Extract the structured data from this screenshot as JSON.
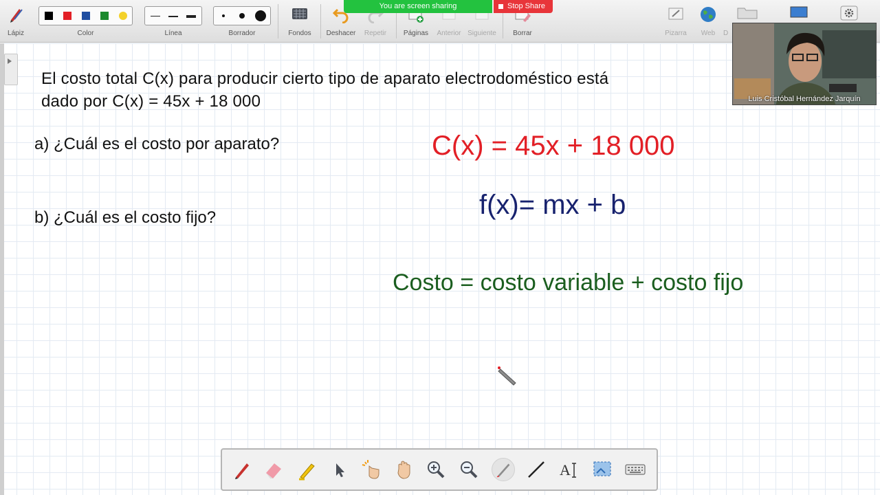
{
  "toolbar": {
    "pencil_label": "Lápiz",
    "color_label": "Color",
    "colors": [
      "#000000",
      "#e21f26",
      "#1f4ea1",
      "#1c8a2e",
      "#f3d12a"
    ],
    "line_label": "Línea",
    "eraser_label": "Borrador",
    "backgrounds_label": "Fondos",
    "undo_label": "Deshacer",
    "redo_label": "Repetir",
    "pages_label": "Páginas",
    "previous_label": "Anterior",
    "next_label": "Siguiente",
    "clear_label": "Borrar",
    "whiteboard_label": "Pizarra",
    "web_label": "Web",
    "desktop_label": "D"
  },
  "share": {
    "banner_text": "You are screen sharing",
    "stop_label": "Stop Share"
  },
  "board": {
    "problem_line1": "El costo total C(x) para producir cierto tipo de aparato electrodoméstico está",
    "problem_line2": "dado por C(x) = 45x + 18 000",
    "question_a": "a) ¿Cuál es el costo por aparato?",
    "question_b": "b) ¿Cuál es el costo fijo?",
    "equation_red": "C(x) = 45x + 18 000",
    "equation_blue": "f(x)= mx + b",
    "equation_green": "Costo = costo variable + costo fijo"
  },
  "webcam": {
    "participant_name": "Luis Cristóbal Hernández Jarquín"
  },
  "bottom_toolbar": {
    "tools": [
      "red-pen-icon",
      "eraser-icon",
      "highlighter-icon",
      "select-arrow-icon",
      "magic-pointer-icon",
      "hand-pan-icon",
      "zoom-in-icon",
      "zoom-out-icon",
      "laser-pen-icon",
      "line-icon",
      "text-tool-icon",
      "screen-capture-icon",
      "keyboard-icon"
    ],
    "active_tool": "laser-pen-icon"
  }
}
